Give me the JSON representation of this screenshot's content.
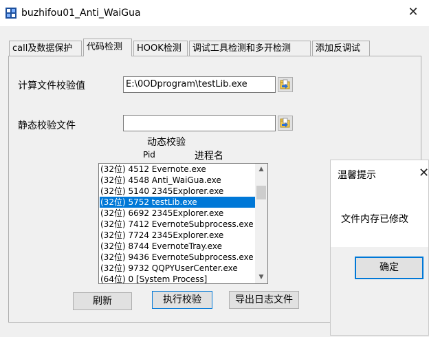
{
  "window": {
    "title": "buzhifou01_Anti_WaiGua",
    "close_glyph": "✕"
  },
  "tabs": [
    {
      "label": "call及数据保护",
      "active": false
    },
    {
      "label": "代码检测",
      "active": true
    },
    {
      "label": "HOOK检测",
      "active": false
    },
    {
      "label": "调试工具检测和多开检测",
      "active": false
    },
    {
      "label": "添加反调试",
      "active": false
    }
  ],
  "checksum": {
    "file_label": "计算文件校验值",
    "file_value": "E:\\0ODprogram\\testLib.exe",
    "static_label": "静态校验文件",
    "static_value": "",
    "browse_icon": "folder-open-icon"
  },
  "process_list": {
    "header": "动态校验",
    "col_pid": "Pid",
    "col_name": "进程名",
    "rows": [
      "(32位) 4512 Evernote.exe",
      "(32位) 4548 Anti_WaiGua.exe",
      "(32位) 5140 2345Explorer.exe",
      "(32位) 5752 testLib.exe",
      "(32位) 6692 2345Explorer.exe",
      "(32位) 7412 EvernoteSubprocess.exe",
      "(32位) 7724 2345Explorer.exe",
      "(32位) 8744 EvernoteTray.exe",
      "(32位) 9436 EvernoteSubprocess.exe",
      "(32位) 9732 QQPYUserCenter.exe",
      "(64位)    0 [System Process]"
    ],
    "selected_text": "(32位) 5752 testLib.exe"
  },
  "buttons": {
    "refresh": "刷新",
    "run_check": "执行校验",
    "export_log": "导出日志文件"
  },
  "dialog": {
    "title": "温馨提示",
    "message": "文件内存已修改",
    "ok": "确定",
    "close_glyph": "✕"
  },
  "colors": {
    "selection": "#0078d7",
    "focus": "#0078d7"
  }
}
